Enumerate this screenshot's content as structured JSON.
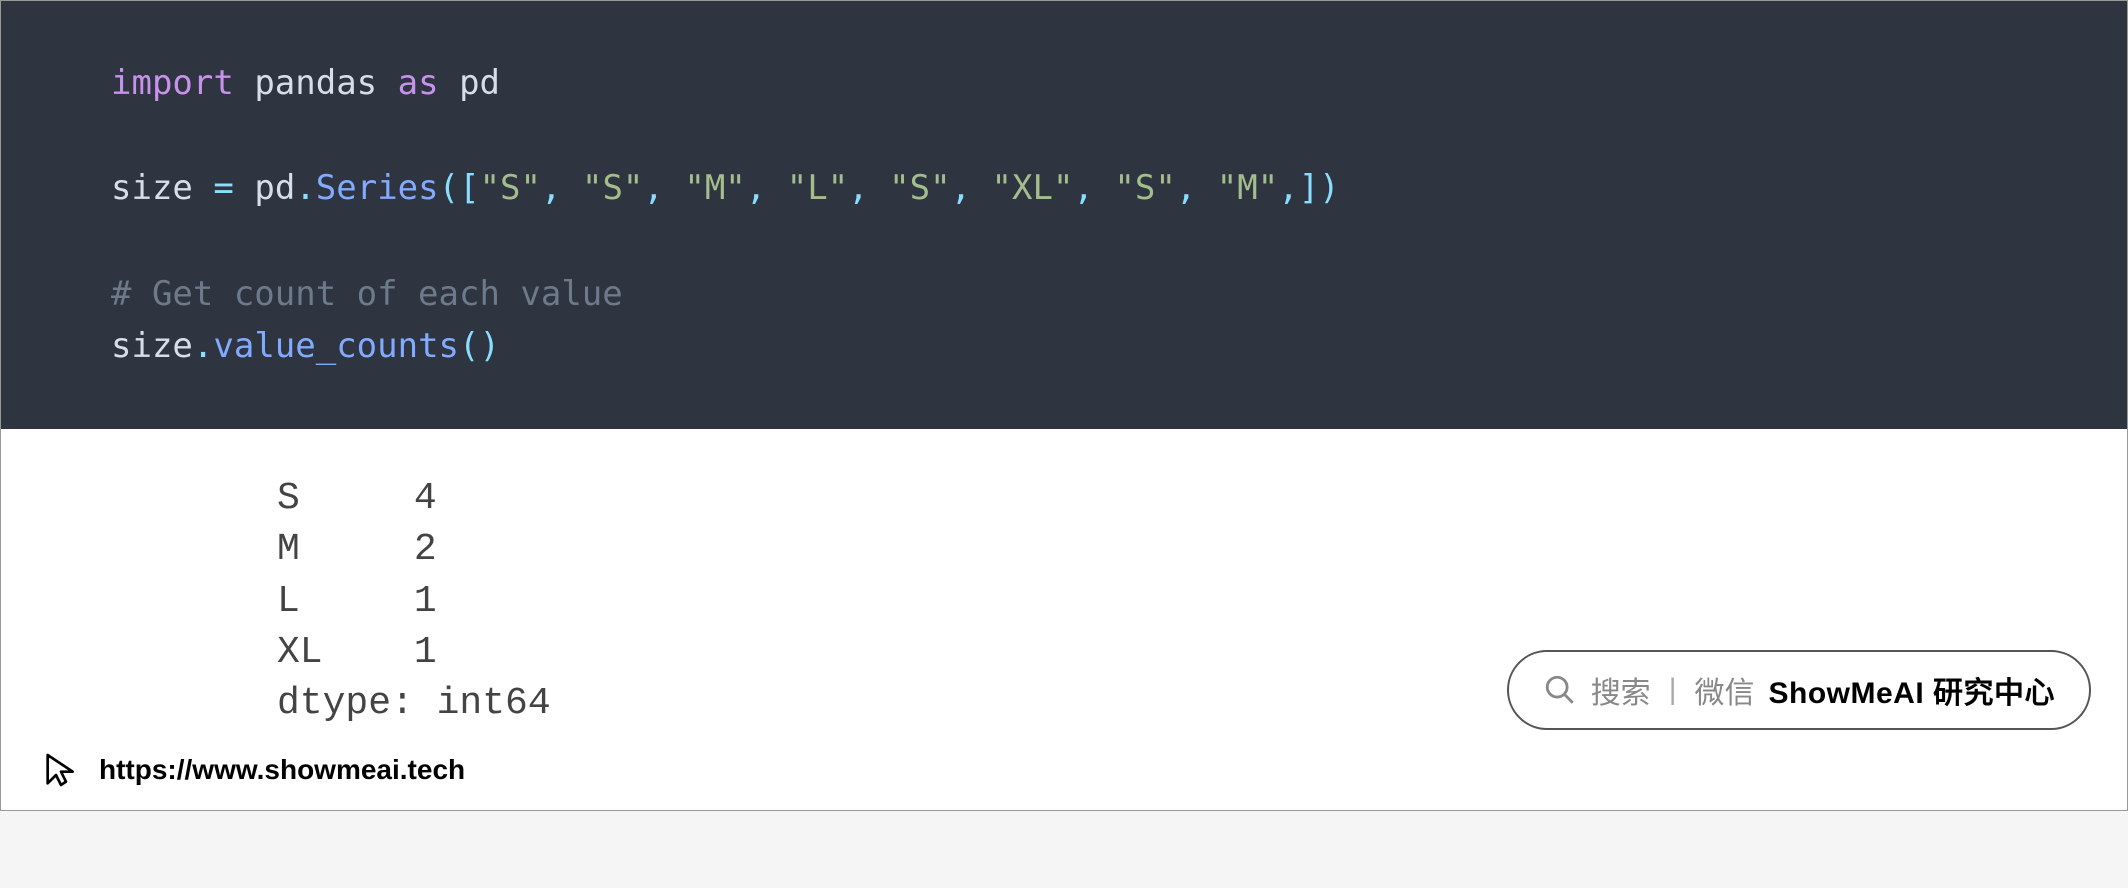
{
  "code": {
    "line1": {
      "kw_import": "import",
      "mod": "pandas",
      "kw_as": "as",
      "alias": "pd"
    },
    "line3": {
      "var": "size",
      "eq": "=",
      "obj": "pd",
      "dot": ".",
      "fn": "Series",
      "lp": "(",
      "lb": "[",
      "s1": "\"S\"",
      "c1": ",",
      "sp1": " ",
      "s2": "\"S\"",
      "c2": ",",
      "sp2": " ",
      "s3": "\"M\"",
      "c3": ",",
      "sp3": " ",
      "s4": "\"L\"",
      "c4": ",",
      "sp4": " ",
      "s5": "\"S\"",
      "c5": ",",
      "sp5": " ",
      "s6": "\"XL\"",
      "c6": ",",
      "sp6": " ",
      "s7": "\"S\"",
      "c7": ",",
      "sp7": " ",
      "s8": "\"M\"",
      "c8": ",",
      "rb": "]",
      "rp": ")"
    },
    "line5_comment": "# Get count of each value",
    "line6": {
      "obj": "size",
      "dot": ".",
      "fn": "value_counts",
      "lp": "(",
      "rp": ")"
    }
  },
  "output": {
    "rows": [
      {
        "label": "S",
        "value": "4"
      },
      {
        "label": "M",
        "value": "2"
      },
      {
        "label": "L",
        "value": "1"
      },
      {
        "label": "XL",
        "value": "1"
      }
    ],
    "dtype_line": "dtype: int64"
  },
  "footer": {
    "url": "https://www.showmeai.tech"
  },
  "search_pill": {
    "label_search": "搜索",
    "label_wechat": "微信",
    "brand": "ShowMeAI 研究中心"
  }
}
